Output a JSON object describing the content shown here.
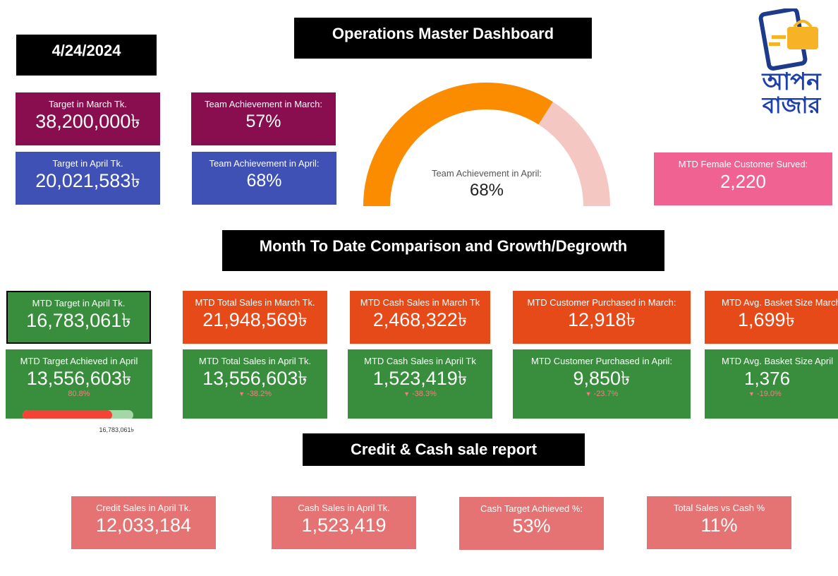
{
  "header": {
    "date": "4/24/2024",
    "title": "Operations Master Dashboard"
  },
  "targets": {
    "march": {
      "label": "Target in March Tk.",
      "value": "38,200,000৳"
    },
    "april": {
      "label": "Target in April Tk.",
      "value": "20,021,583৳"
    },
    "ach_march": {
      "label": "Team Achievement in March:",
      "value": "57%"
    },
    "ach_april": {
      "label": "Team Achievement in April:",
      "value": "68%"
    }
  },
  "gauge": {
    "label": "Team Achievement in April:",
    "value_text": "68%",
    "value": 0.68,
    "fill_color": "#fb8c00",
    "track_color": "#f4c7c3"
  },
  "female": {
    "label": "MTD Female Customer Surved:",
    "value": "2,220"
  },
  "mtd_section": {
    "title": "Month To Date Comparison and Growth/Degrowth"
  },
  "mtd_row1": [
    {
      "label": "MTD Target in April Tk.",
      "value": "16,783,061৳"
    },
    {
      "label": "MTD Total Sales in March Tk.",
      "value": "21,948,569৳"
    },
    {
      "label": "MTD Cash Sales in March Tk",
      "value": "2,468,322৳"
    },
    {
      "label": "MTD Customer Purchased in March:",
      "value": "12,918৳"
    },
    {
      "label": "MTD Avg. Basket Size March",
      "value": "1,699৳"
    }
  ],
  "mtd_row2": [
    {
      "label": "MTD Target Achieved in April",
      "value": "13,556,603৳",
      "change": "80.8%"
    },
    {
      "label": "MTD Total Sales in April Tk.",
      "value": "13,556,603৳",
      "change": "-38.2%"
    },
    {
      "label": "MTD Cash Sales in April Tk",
      "value": "1,523,419৳",
      "change": "-38.3%"
    },
    {
      "label": "MTD Customer Purchased in April:",
      "value": "9,850৳",
      "change": "-23.7%"
    },
    {
      "label": "MTD Avg. Basket Size April",
      "value": "1,376",
      "change": "-19.0%"
    }
  ],
  "progress": {
    "value": 0.808,
    "target_label": "16,783,061৳",
    "fill_color": "#f44336",
    "track_color": "#a5d6a7"
  },
  "credit_section": {
    "title": "Credit & Cash sale report"
  },
  "credit_cards": [
    {
      "label": "Credit Sales in April Tk.",
      "value": "12,033,184"
    },
    {
      "label": "Cash Sales in April Tk.",
      "value": "1,523,419"
    },
    {
      "label": "Cash Target Achieved %:",
      "value": "53%"
    },
    {
      "label": "Total Sales vs Cash %",
      "value": "11%"
    }
  ],
  "logo": {
    "text_line1": "আপন",
    "text_line2": "বাজার",
    "name": "apon-bazar-logo"
  },
  "colors": {
    "maroon": "#880e4f",
    "indigo": "#3f51b5",
    "pink": "#f06292",
    "green": "#388e3c",
    "orange": "#e64a19",
    "salmon": "#e57373"
  }
}
